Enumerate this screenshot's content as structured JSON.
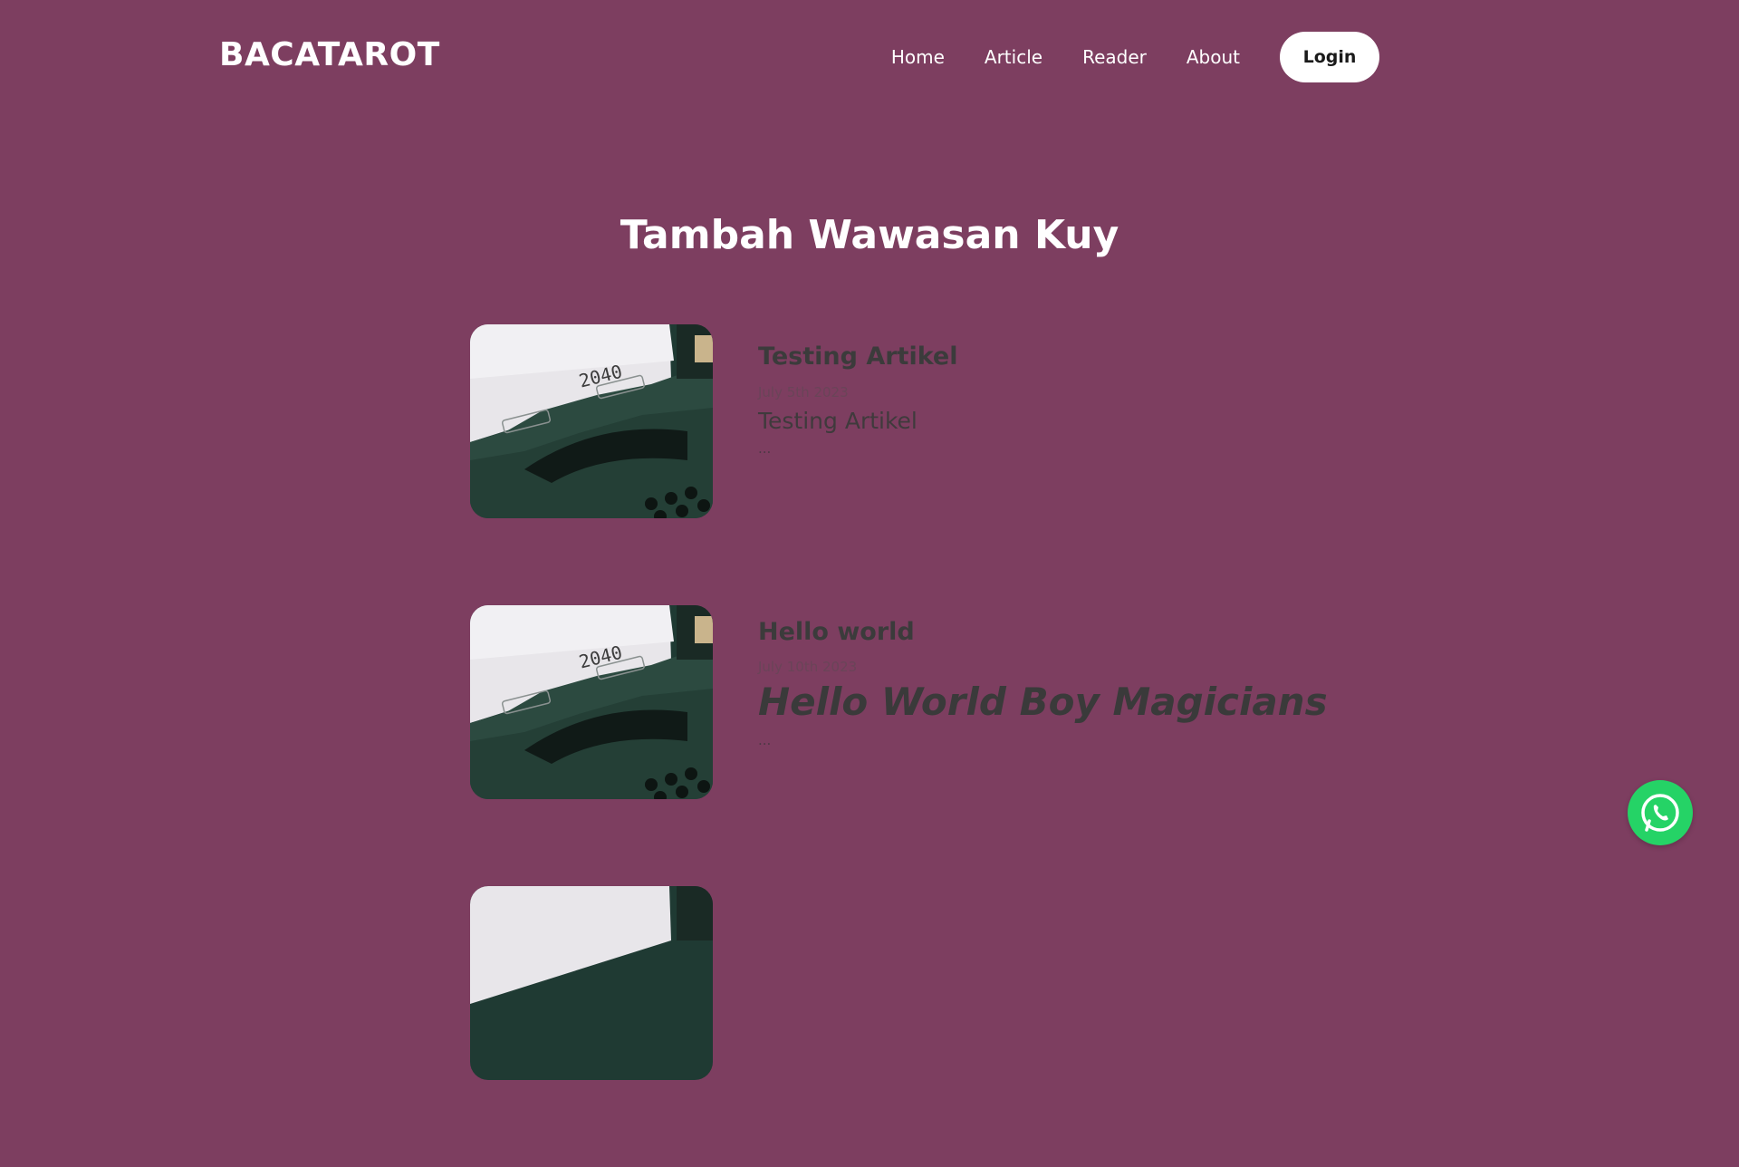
{
  "brand": {
    "logo_text": "BACATAROT"
  },
  "nav": {
    "links": [
      "Home",
      "Article",
      "Reader",
      "About"
    ],
    "login_label": "Login"
  },
  "page_title": "Tambah Wawasan Kuy",
  "articles": [
    {
      "title": "Testing Artikel",
      "date": "July 5th 2023",
      "excerpt": "Testing Artikel",
      "ellipsis": "...",
      "thumb_text": "2040"
    },
    {
      "title": "Hello world",
      "date": "July 10th 2023",
      "excerpt": "Hello World Boy Magicians",
      "ellipsis": "...",
      "thumb_text": "2040"
    },
    {
      "title": "",
      "date": "",
      "excerpt": "",
      "ellipsis": "",
      "thumb_text": ""
    }
  ],
  "floating": {
    "icon": "whatsapp-icon"
  },
  "colors": {
    "background": "#7d3e60",
    "login_bg": "#ffffff",
    "whatsapp": "#25d366",
    "article_text": "#3b3b3b"
  }
}
